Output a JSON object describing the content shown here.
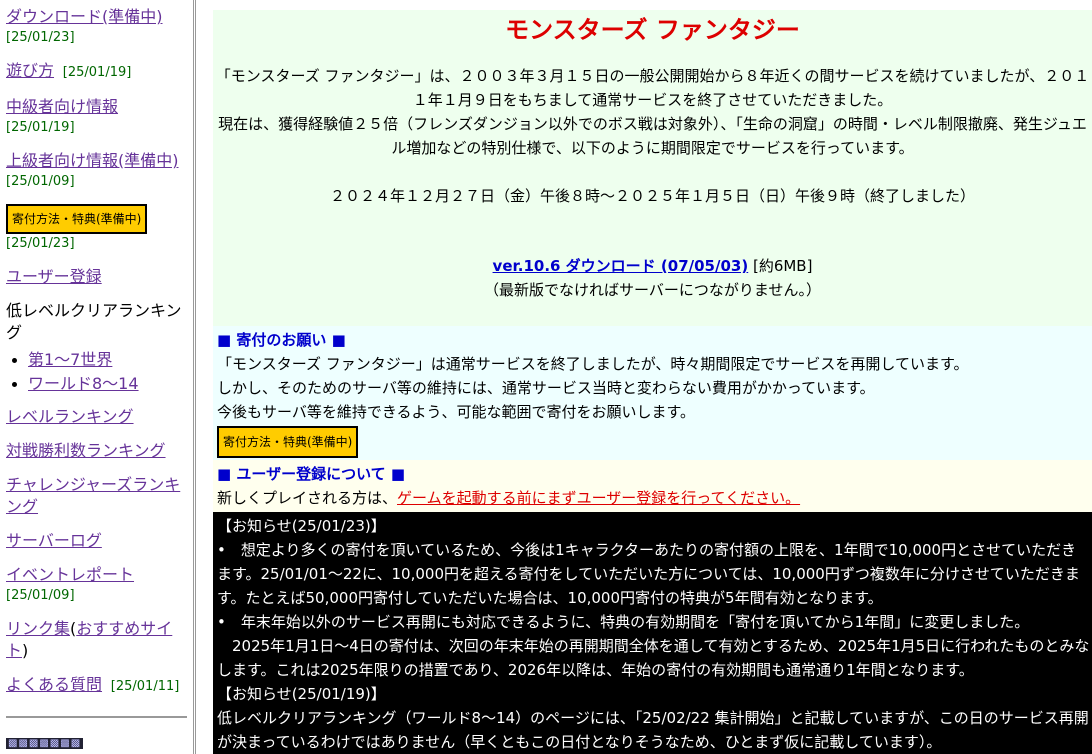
{
  "sidebar": {
    "download": {
      "label": "ダウンロード(準備中)",
      "date": "[25/01/23]"
    },
    "howto": {
      "label": "遊び方",
      "date": "[25/01/19]"
    },
    "intermediate": {
      "label": "中級者向け情報",
      "date": "[25/01/19]"
    },
    "advanced": {
      "label": "上級者向け情報(準備中)",
      "date": "[25/01/09]"
    },
    "donate": {
      "label": "寄付方法・特典(準備中)",
      "date": "[25/01/23]"
    },
    "register": {
      "label": "ユーザー登録"
    },
    "lowlevel_heading": "低レベルクリアランキング",
    "lowlevel_items": [
      "第1〜7世界",
      "ワールド8〜14"
    ],
    "level_ranking": "レベルランキング",
    "battle_ranking": "対戦勝利数ランキング",
    "challengers_ranking": "チャレンジャーズランキング",
    "server_log": "サーバーログ",
    "event_report": {
      "label": "イベントレポート",
      "date": "[25/01/09]"
    },
    "links": {
      "label1": "リンク集",
      "paren_open": "(",
      "label2": "おすすめサイト",
      "paren_close": ")"
    },
    "faq": {
      "label": "よくある質問",
      "date": "[25/01/11]"
    }
  },
  "main": {
    "title": "モンスターズ ファンタジー",
    "intro_lines": [
      "「モンスターズ ファンタジー」は、２００３年３月１５日の一般公開開始から８年近くの間サービスを続けていましたが、２０１１年１月９日をもちまして通常サービスを終了させていただきました。",
      "現在は、獲得経験値２５倍（フレンズダンジョン以外でのボス戦は対象外）、「生命の洞窟」の時間・レベル制限撤廃、発生ジュエル増加などの特別仕様で、以下のように期間限定でサービスを行っています。"
    ],
    "schedule": "２０２４年１２月２７日（金）午後８時〜２０２５年１月５日（日）午後９時（終了しました）",
    "download_link": "ver.10.6 ダウンロード (07/05/03)",
    "download_size": " [約6MB]",
    "download_note": "（最新版でなければサーバーにつながりません。）"
  },
  "donate_section": {
    "title": "■ 寄付のお願い ■",
    "lines": [
      "「モンスターズ ファンタジー」は通常サービスを終了しましたが、時々期間限定でサービスを再開しています。",
      "しかし、そのためのサーバ等の維持には、通常サービス当時と変わらない費用がかかっています。",
      "今後もサーバ等を維持できるよう、可能な範囲で寄付をお願いします。"
    ],
    "button": "寄付方法・特典(準備中)"
  },
  "register_section": {
    "title": "■ ユーザー登録について ■",
    "text": "新しくプレイされる方は、",
    "link": "ゲームを起動する前にまずユーザー登録を行ってください。"
  },
  "notices": {
    "head1": "【お知らせ(25/01/23)】",
    "item1": "•　想定より多くの寄付を頂いているため、今後は1キャラクターあたりの寄付額の上限を、1年間で10,000円とさせていただきます。25/01/01〜22に、10,000円を超える寄付をしていただいた方については、10,000円ずつ複数年に分けさせていただきます。たとえば50,000円寄付していただいた場合は、10,000円寄付の特典が5年間有効となります。",
    "item2": "•　年末年始以外のサービス再開にも対応できるように、特典の有効期間を「寄付を頂いてから1年間」に変更しました。",
    "item2b": "　2025年1月1日〜4日の寄付は、次回の年末年始の再開期間全体を通して有効とするため、2025年1月5日に行われたものとみなします。これは2025年限りの措置であり、2026年以降は、年始の寄付の有効期間も通常通り1年間となります。",
    "head2": "【お知らせ(25/01/19)】",
    "item3": "低レベルクリアランキング（ワールド8〜14）のページには、「25/02/22 集計開始」と記載していますが、この日のサービス再開が決まっているわけではありません（早くともこの日付となりそうなため、ひとまず仮に記載しています）。"
  }
}
